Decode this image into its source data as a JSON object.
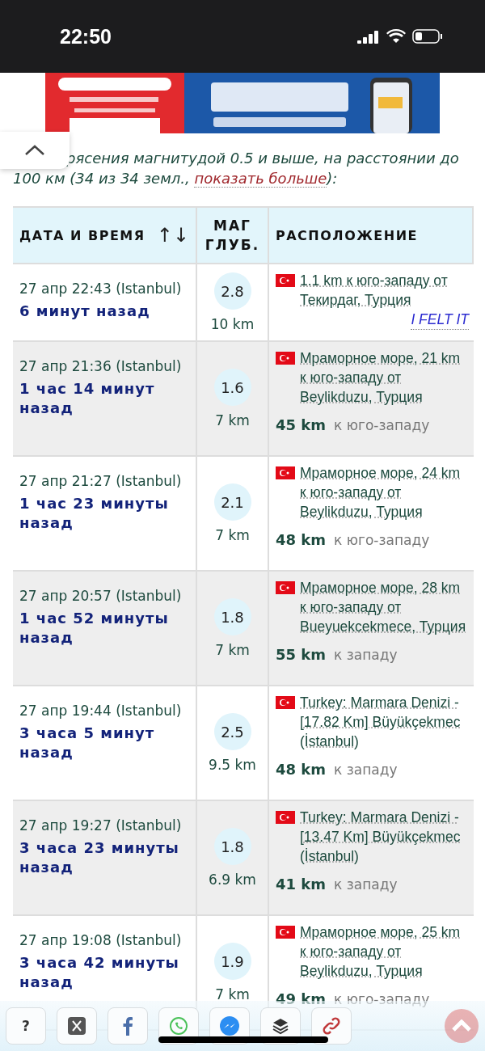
{
  "status_bar": {
    "time": "22:50"
  },
  "intro": {
    "text": "рясения магнитудой 0.5 и выше, на расстоянии до 100 км (34 из 34 земл., ",
    "link": "показать больше",
    "tail": "):"
  },
  "table": {
    "columns": [
      {
        "label": "ДАТА И ВРЕМЯ",
        "sort": "↑↓"
      },
      {
        "label": "МАГ ГЛУБ."
      },
      {
        "label": "РАСПОЛОЖЕНИЕ"
      }
    ],
    "rows": [
      {
        "date": "27 апр 22:43 (Istanbul)",
        "ago": "6 минут назад",
        "mag": "2.8",
        "depth": "10 km",
        "location": "1.1 km к юго-западу от Текирдаг, Турция",
        "felt": "I FELT IT"
      },
      {
        "date": "27 апр 21:36 (Istanbul)",
        "ago": "1 час 14 минут назад",
        "mag": "1.6",
        "depth": "7 km",
        "location": "Мраморное море, 21 km к юго-западу от Beylikduzu, Турция",
        "distance": "45 km",
        "direction": "к юго-западу"
      },
      {
        "date": "27 апр 21:27 (Istanbul)",
        "ago": "1 час 23 минуты назад",
        "mag": "2.1",
        "depth": "7 km",
        "location": "Мраморное море, 24 km к юго-западу от Beylikduzu, Турция",
        "distance": "48 km",
        "direction": "к юго-западу"
      },
      {
        "date": "27 апр 20:57 (Istanbul)",
        "ago": "1 час 52 минуты назад",
        "mag": "1.8",
        "depth": "7 km",
        "location": "Мраморное море, 28 km к юго-западу от Bueyuekcekmece, Турция",
        "distance": "55 km",
        "direction": "к западу"
      },
      {
        "date": "27 апр 19:44 (Istanbul)",
        "ago": "3 часа 5 минут назад",
        "mag": "2.5",
        "depth": "9.5 km",
        "location": "Turkey: Marmara Denizi - [17.82 Km] Büyükçekmec (İstanbul)",
        "distance": "48 km",
        "direction": "к западу"
      },
      {
        "date": "27 апр 19:27 (Istanbul)",
        "ago": "3 часа 23 минуты назад",
        "mag": "1.8",
        "depth": "6.9 km",
        "location": "Turkey: Marmara Denizi - [13.47 Km] Büyükçekmec (İstanbul)",
        "distance": "41 km",
        "direction": "к западу"
      },
      {
        "date": "27 апр 19:08 (Istanbul)",
        "ago": "3 часа 42 минуты назад",
        "mag": "1.9",
        "depth": "7 km",
        "location": "Мраморное море, 25 km к юго-западу от Beylikduzu, Турция",
        "distance": "49 km",
        "direction": "к юго-западу"
      }
    ]
  },
  "share_bar": [
    {
      "kind": "help",
      "label": "?"
    },
    {
      "kind": "x"
    },
    {
      "kind": "facebook"
    },
    {
      "kind": "whatsapp"
    },
    {
      "kind": "messenger"
    },
    {
      "kind": "layers"
    },
    {
      "kind": "link"
    }
  ]
}
